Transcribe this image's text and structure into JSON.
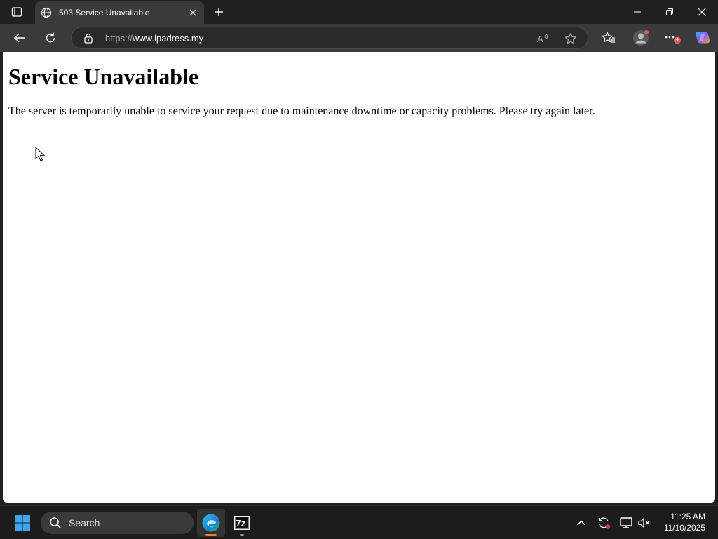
{
  "tab": {
    "title": "503 Service Unavailable"
  },
  "address_bar": {
    "scheme": "https://",
    "host": "www.ipadress.my"
  },
  "page": {
    "heading": "Service Unavailable",
    "message": "The server is temporarily unable to service your request due to maintenance downtime or capacity problems. Please try again later."
  },
  "taskbar": {
    "search_placeholder": "Search",
    "clock_time": "11:25 AM",
    "clock_date": "11/10/2025"
  },
  "colors": {
    "accent_edge": "#3b8bd9",
    "notification_badge": "#e05a5a",
    "copilot": "#8a5cf6"
  },
  "icons": [
    "tab-actions-icon",
    "globe-icon",
    "close-icon",
    "plus-icon",
    "minimize-icon",
    "restore-icon",
    "window-close-icon",
    "back-icon",
    "refresh-icon",
    "lock-icon",
    "read-aloud-icon",
    "favorite-star-icon",
    "favorites-icon",
    "profile-icon",
    "more-icon",
    "copilot-icon",
    "windows-start-icon",
    "search-icon",
    "edge-icon",
    "7zip-icon",
    "chevron-up-icon",
    "sync-icon",
    "display-icon",
    "volume-muted-icon"
  ]
}
